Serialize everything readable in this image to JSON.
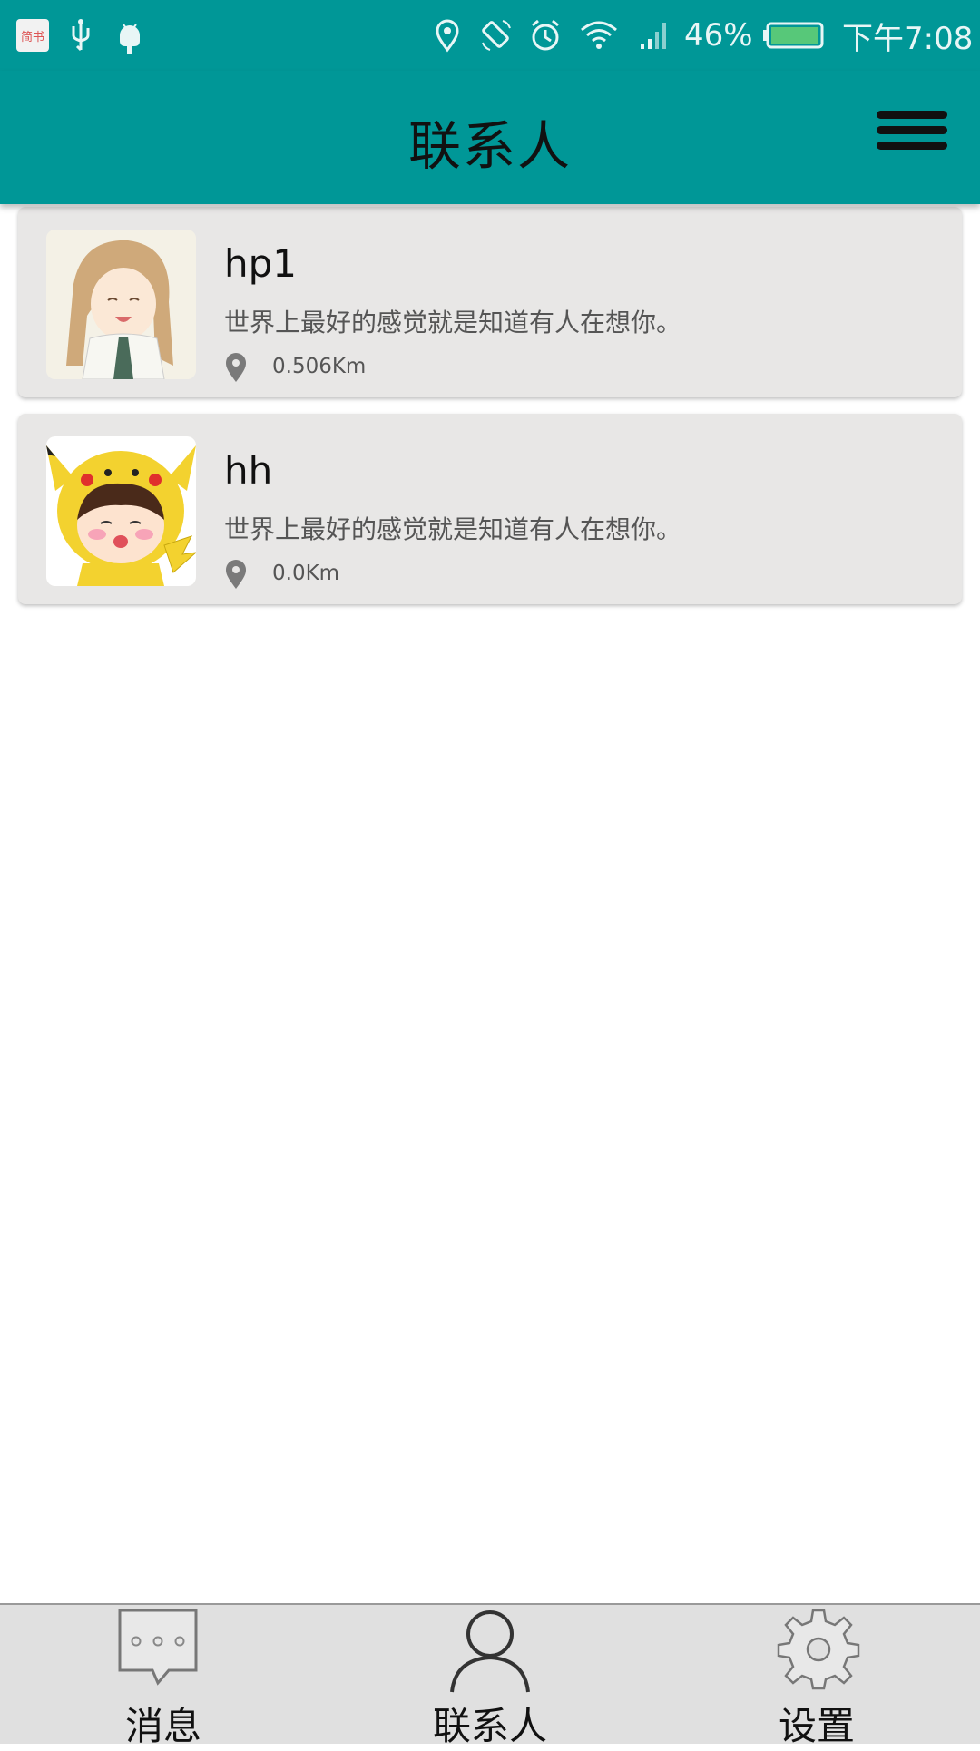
{
  "status_bar": {
    "app_badge": "简书",
    "battery": "46%",
    "time": "下午7:08",
    "icons": [
      "jianshu-app-icon",
      "usb-icon",
      "android-debug-icon",
      "location-icon",
      "auto-rotate-icon",
      "alarm-icon",
      "wifi-icon",
      "signal-icon",
      "battery-icon"
    ]
  },
  "toolbar": {
    "title": "联系人",
    "menu_icon": "hamburger-menu-icon",
    "background": "#009797"
  },
  "contacts": [
    {
      "name": "hp1",
      "signature": "世界上最好的感觉就是知道有人在想你。",
      "distance": "0.506Km",
      "avatar": "anime-girl-avatar"
    },
    {
      "name": "hh",
      "signature": "世界上最好的感觉就是知道有人在想你。",
      "distance": "0.0Km",
      "avatar": "pikachu-costume-avatar"
    }
  ],
  "bottom_nav": [
    {
      "label": "消息",
      "icon": "message-bubble-icon"
    },
    {
      "label": "联系人",
      "icon": "person-icon"
    },
    {
      "label": "设置",
      "icon": "gear-icon"
    }
  ],
  "colors": {
    "accent": "#009797",
    "card": "#e8e7e6",
    "nav_background": "#e0e0e0"
  }
}
